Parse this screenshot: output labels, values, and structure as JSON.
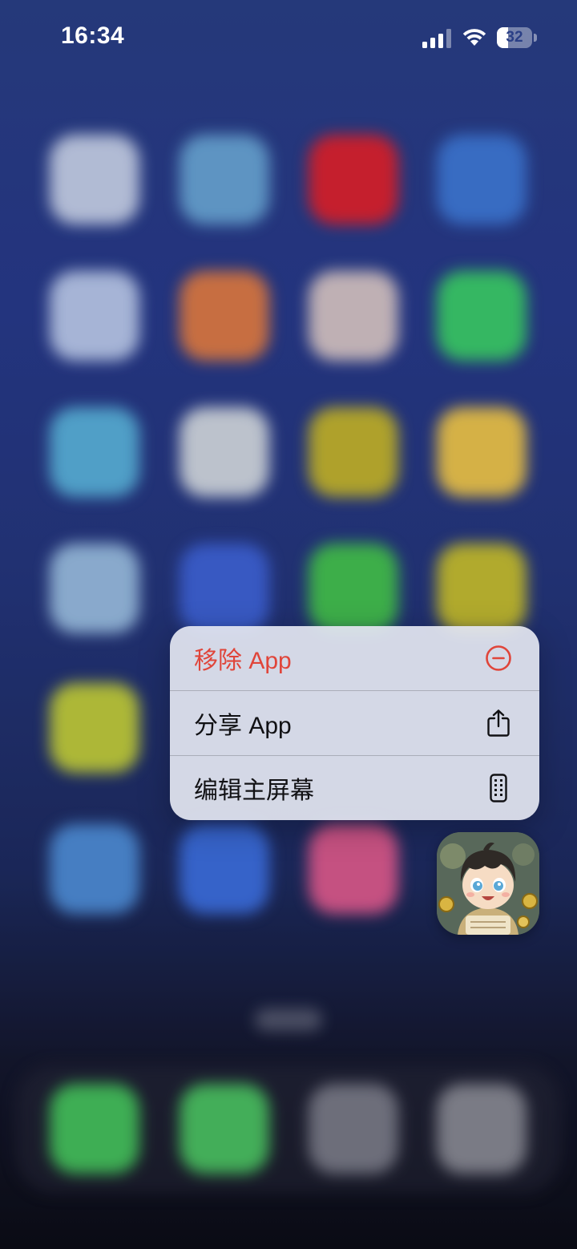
{
  "status_bar": {
    "time": "16:34",
    "battery_level": "32",
    "battery_fraction": 0.32
  },
  "context_menu": {
    "items": [
      {
        "label": "移除 App",
        "icon": "minus-circle-icon",
        "color": "#e0453a",
        "destructive": true
      },
      {
        "label": "分享 App",
        "icon": "share-icon",
        "color": "#111114",
        "destructive": false
      },
      {
        "label": "编辑主屏幕",
        "icon": "phone-grid-icon",
        "color": "#111114",
        "destructive": false
      }
    ]
  },
  "app_icon": {
    "icon": "game-character-app-icon"
  },
  "colors": {
    "destructive": "#e0453a",
    "menu_background": "#e2e5f0",
    "wallpaper": "#2a3f86"
  }
}
